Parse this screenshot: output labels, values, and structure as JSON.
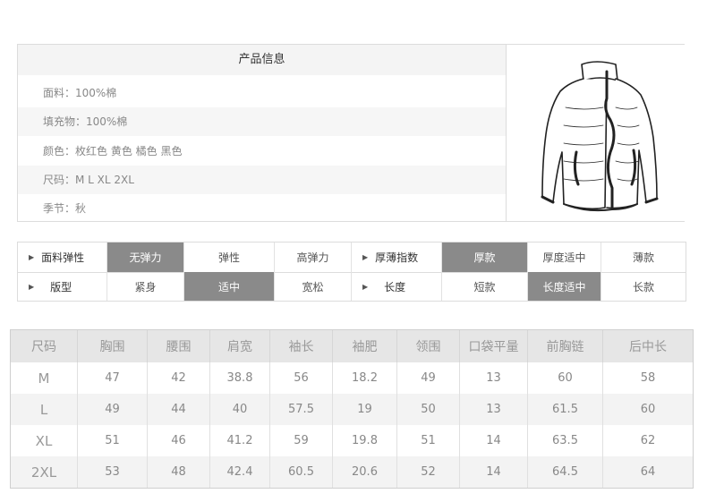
{
  "info": {
    "title": "产品信息",
    "rows": [
      {
        "text": "面料：100%棉"
      },
      {
        "text": "填充物：100%棉"
      },
      {
        "text": "颜色：枚红色 黄色 橘色 黑色"
      },
      {
        "text": "尺码：M L XL 2XL"
      },
      {
        "text": "季节：秋"
      }
    ],
    "image_icon": "jacket-sketch"
  },
  "attributes": {
    "row1": {
      "label1": "面料弹性",
      "options1": [
        "无弹力",
        "弹性",
        "高弹力"
      ],
      "selected1": "无弹力",
      "label2": "厚薄指数",
      "options2": [
        "厚款",
        "厚度适中",
        "薄款"
      ],
      "selected2": "厚款"
    },
    "row2": {
      "label1": "版型",
      "options1": [
        "紧身",
        "适中",
        "宽松"
      ],
      "selected1": "适中",
      "label2": "长度",
      "options2": [
        "短款",
        "长度适中",
        "长款"
      ],
      "selected2": "长度适中"
    },
    "selected_color": "#8a8a8a"
  },
  "size_table": {
    "headers": [
      "尺码",
      "胸围",
      "腰围",
      "肩宽",
      "袖长",
      "袖肥",
      "领围",
      "口袋平量",
      "前胸链",
      "后中长"
    ],
    "rows": [
      [
        "M",
        "47",
        "42",
        "38.8",
        "56",
        "18.2",
        "49",
        "13",
        "60",
        "58"
      ],
      [
        "L",
        "49",
        "44",
        "40",
        "57.5",
        "19",
        "50",
        "13",
        "61.5",
        "60"
      ],
      [
        "XL",
        "51",
        "46",
        "41.2",
        "59",
        "19.8",
        "51",
        "14",
        "63.5",
        "62"
      ],
      [
        "2XL",
        "53",
        "48",
        "42.4",
        "60.5",
        "20.6",
        "52",
        "14",
        "64.5",
        "64"
      ]
    ]
  }
}
